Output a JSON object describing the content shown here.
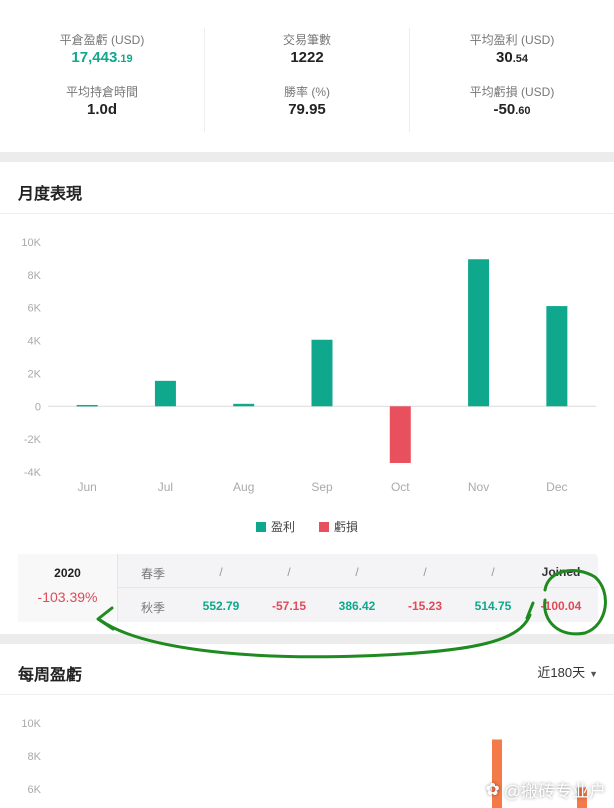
{
  "stats": {
    "col1": [
      {
        "label": "平倉盈虧 (USD)",
        "main": "17,443",
        "dec": ".19",
        "color": "green"
      },
      {
        "label": "平均持倉時間",
        "main": "1.0d",
        "dec": "",
        "color": "dark"
      }
    ],
    "col2": [
      {
        "label": "交易筆數",
        "main": "1222",
        "dec": "",
        "color": "dark"
      },
      {
        "label": "勝率 (%)",
        "main": "79.95",
        "dec": "",
        "color": "dark"
      }
    ],
    "col3": [
      {
        "label": "平均盈利 (USD)",
        "main": "30",
        "dec": ".54",
        "color": "dark"
      },
      {
        "label": "平均虧損 (USD)",
        "main": "-50",
        "dec": ".60",
        "color": "dark"
      }
    ]
  },
  "monthly": {
    "title": "月度表現",
    "legend": {
      "profit": "盈利",
      "loss": "虧損"
    },
    "colors": {
      "profit": "#0fa88c",
      "loss": "#e8505d"
    },
    "chart_data": {
      "type": "bar",
      "categories": [
        "Jun",
        "Jul",
        "Aug",
        "Sep",
        "Oct",
        "Nov",
        "Dec"
      ],
      "values": [
        80,
        1550,
        150,
        4050,
        -3450,
        8950,
        6100
      ],
      "yticks": [
        "10K",
        "8K",
        "6K",
        "4K",
        "2K",
        "0",
        "-2K",
        "-4K"
      ],
      "ylim": [
        -4000,
        10000
      ],
      "legend_position": "bottom"
    }
  },
  "seasons": {
    "year": "2020",
    "year_pct": "-103.39%",
    "spring": {
      "name": "春季",
      "values": [
        "/",
        "/",
        "/",
        "/",
        "/",
        "Joined"
      ]
    },
    "autumn": {
      "name": "秋季",
      "values": [
        "552.79",
        "-57.15",
        "386.42",
        "-15.23",
        "514.75",
        "-100.04"
      ]
    }
  },
  "weekly": {
    "title": "每周盈虧",
    "range": "近180天",
    "bar_color": "#f47a4a",
    "chart_data": {
      "type": "bar",
      "yticks": [
        "10K",
        "8K",
        "6K"
      ],
      "visible_bars": [
        {
          "value": 9000
        },
        {
          "value": 6100
        }
      ]
    }
  },
  "watermark": "@搬砖专业户"
}
